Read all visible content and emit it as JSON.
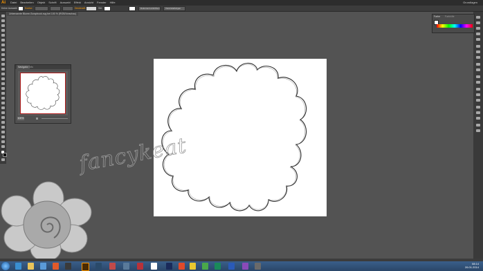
{
  "app": {
    "logo": "Ai"
  },
  "menu": {
    "items": [
      "Datei",
      "Bearbeiten",
      "Objekt",
      "Schrift",
      "Auswahl",
      "Effekt",
      "Ansicht",
      "Fenster",
      "Hilfe"
    ],
    "workspace": "Grundlagen"
  },
  "control_bar": {
    "selection": "Keine Auswahl",
    "stroke_label": "Kontur:",
    "opacity_label": "Deckkraft:",
    "style_label": "Stil:",
    "doc_settings": "Dokument einrichten",
    "preferences": "Voreinstellungen"
  },
  "document": {
    "tab_title": "Unbenannte Blume-Scrapbook.svg bei 100 % (RGB/Vorschau)"
  },
  "color_panel": {
    "tab1": "Farbe",
    "tab2": "Farbhilfe"
  },
  "navigator": {
    "tab1": "Navigator",
    "tab2": "Info",
    "zoom": "100%"
  },
  "watermark": {
    "text": "fancykeat"
  },
  "taskbar": {
    "time": "08:14",
    "date": "26.01.2014"
  },
  "colors": {
    "accent": "#ff9a00",
    "ui_bg": "#535353",
    "panel": "#3a3a3a"
  }
}
